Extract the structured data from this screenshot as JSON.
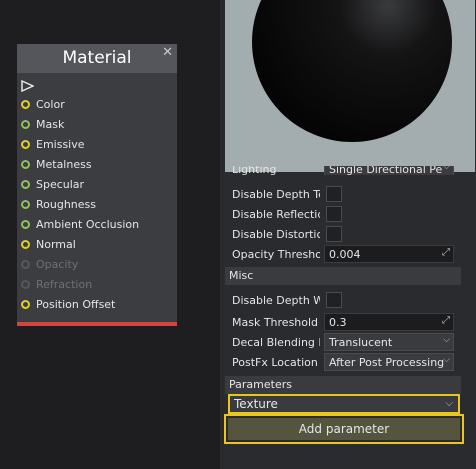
{
  "node": {
    "title": "Material",
    "close_glyph": "✕",
    "inputs": [
      {
        "label": "Color",
        "pin": "yellow",
        "enabled": true
      },
      {
        "label": "Mask",
        "pin": "green",
        "enabled": true
      },
      {
        "label": "Emissive",
        "pin": "yellow",
        "enabled": true
      },
      {
        "label": "Metalness",
        "pin": "green",
        "enabled": true
      },
      {
        "label": "Specular",
        "pin": "green",
        "enabled": true
      },
      {
        "label": "Roughness",
        "pin": "green",
        "enabled": true
      },
      {
        "label": "Ambient Occlusion",
        "pin": "green",
        "enabled": true
      },
      {
        "label": "Normal",
        "pin": "yellow",
        "enabled": true
      },
      {
        "label": "Opacity",
        "pin": "dim",
        "enabled": false
      },
      {
        "label": "Refraction",
        "pin": "dim",
        "enabled": false
      },
      {
        "label": "Position Offset",
        "pin": "yellow",
        "enabled": true
      }
    ]
  },
  "properties": {
    "top_cut_label": "Lighting",
    "top_cut_value": "Single Directional Pe",
    "disable_depth_test_label": "Disable Depth Te",
    "disable_reflections_label": "Disable Reflectic",
    "disable_distortion_label": "Disable Distortic",
    "opacity_threshold_label": "Opacity Thresho",
    "opacity_threshold_value": "0.004",
    "misc_header": "Misc",
    "disable_depth_write_label": "Disable Depth W",
    "mask_threshold_label": "Mask Threshold",
    "mask_threshold_value": "0.3",
    "decal_blending_label": "Decal Blending M",
    "decal_blending_value": "Translucent",
    "postfx_location_label": "PostFx Location",
    "postfx_location_value": "After Post Processing"
  },
  "parameters": {
    "header": "Parameters",
    "type_value": "Texture",
    "add_button_label": "Add parameter"
  },
  "colors": {
    "pin_yellow": "#e0d02a",
    "pin_green": "#8fc25a",
    "highlight": "#e8c61e",
    "node_footer": "#d4453b"
  }
}
